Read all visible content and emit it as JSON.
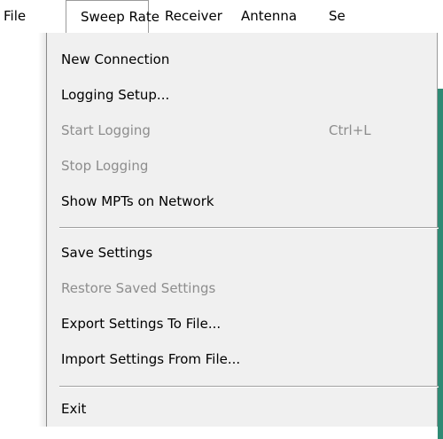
{
  "menubar": {
    "items": [
      {
        "label": "File"
      },
      {
        "label": "Sweep Rate"
      },
      {
        "label": "Receiver"
      },
      {
        "label": "Antenna"
      },
      {
        "label": "Se"
      }
    ]
  },
  "file_menu": {
    "items": [
      {
        "label": "New Connection",
        "enabled": true
      },
      {
        "label": "Logging Setup...",
        "enabled": true
      },
      {
        "label": "Start Logging",
        "shortcut": "Ctrl+L",
        "enabled": false
      },
      {
        "label": "Stop Logging",
        "enabled": false
      },
      {
        "label": "Show MPTs on Network",
        "enabled": true
      },
      {
        "label": "Save Settings",
        "enabled": true
      },
      {
        "label": "Restore Saved Settings",
        "enabled": false
      },
      {
        "label": "Export Settings To File...",
        "enabled": true
      },
      {
        "label": "Import Settings From File...",
        "enabled": true
      },
      {
        "label": "Exit",
        "enabled": true
      }
    ]
  },
  "colors": {
    "disabled_text": "#8d8d8d",
    "menu_background": "#f0f0f0",
    "window_accent": "#2f8a74"
  }
}
